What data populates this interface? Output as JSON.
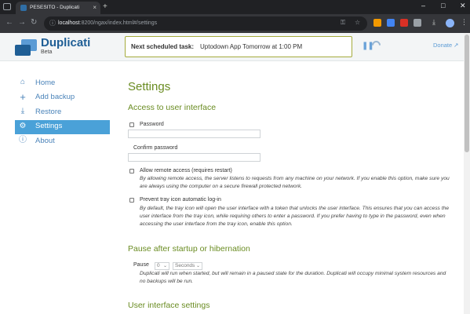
{
  "browser": {
    "tab_title": "PESESITO - Duplicati",
    "tab_close": "×",
    "new_tab": "+",
    "url_host": "localhost",
    "url_path": ":8200/ngax/index.html#/settings",
    "window_controls": {
      "minimize": "–",
      "maximize": "□",
      "close": "✕"
    },
    "nav": {
      "back": "←",
      "forward": "→",
      "reload": "↻"
    },
    "omni_icons": {
      "info": "ⓘ",
      "key": "⚿",
      "star": "☆"
    },
    "toolbar_icons": {
      "download": "⤓",
      "menu": "⋮"
    },
    "extension_colors": [
      "#f29900",
      "#4285f4",
      "#d93025",
      "#9aa0a6"
    ]
  },
  "header": {
    "app_name": "Duplicati",
    "app_subtitle": "Beta",
    "scheduled_label": "Next scheduled task:",
    "scheduled_value": "Uptodown App Tomorrow at 1:00 PM",
    "pause_glyph": "❚❚",
    "donate_label": "Donate ↗"
  },
  "sidebar": {
    "items": [
      {
        "label": "Home",
        "icon": "home-icon",
        "glyph": "⌂",
        "active": false
      },
      {
        "label": "Add backup",
        "icon": "plus-icon",
        "glyph": "+",
        "active": false
      },
      {
        "label": "Restore",
        "icon": "restore-icon",
        "glyph": "⤓",
        "active": false
      },
      {
        "label": "Settings",
        "icon": "gear-icon",
        "glyph": "⚙",
        "active": true
      },
      {
        "label": "About",
        "icon": "info-icon",
        "glyph": "ⓘ",
        "active": false
      }
    ]
  },
  "settings": {
    "title": "Settings",
    "access_heading": "Access to user interface",
    "password_label": "Password",
    "confirm_password_label": "Confirm password",
    "remote_access_label": "Allow remote access (requires restart)",
    "remote_access_desc": "By allowing remote access, the server listens to requests from any machine on your network. If you enable this option, make sure you are always using the computer on a secure firewall protected network.",
    "tray_label": "Prevent tray icon automatic log-in",
    "tray_desc": "By default, the tray icon will open the user interface with a token that unlocks the user interface. This ensures that you can access the user interface from the tray icon, while requiring others to enter a password. If you prefer having to type in the password, even when accessing the user interface from the tray icon, enable this option.",
    "pause_heading": "Pause after startup or hibernation",
    "pause_label": "Pause",
    "pause_value": "0",
    "pause_unit": "Seconds",
    "pause_desc": "Duplicati will run when started, but will remain in a paused state for the duration. Duplicati will occupy minimal system resources and no backups will be run.",
    "ui_heading": "User interface settings"
  },
  "colors": {
    "accent": "#4aa1d8",
    "heading_green": "#6a8c22",
    "link_blue": "#4a83b9",
    "schedule_border": "#a5ab3c"
  }
}
